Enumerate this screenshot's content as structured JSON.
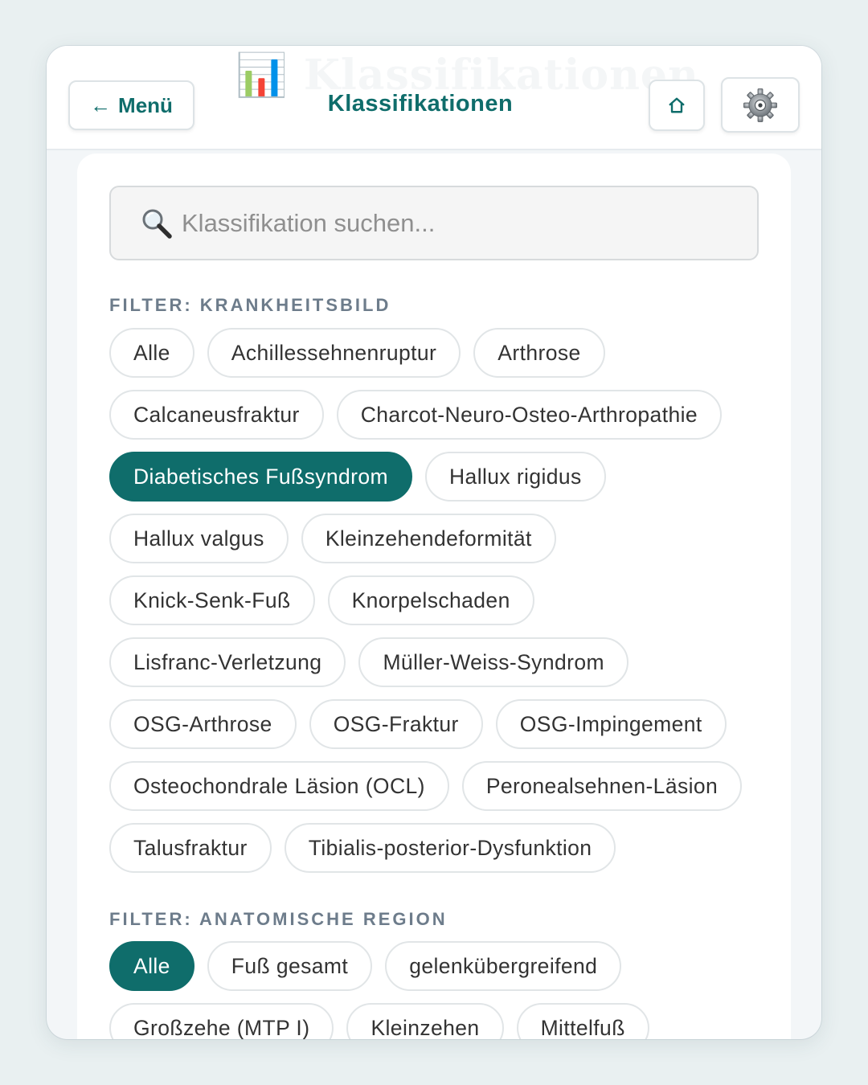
{
  "header": {
    "ghost_title": "📊 Klassifikationen",
    "title": "Klassifikationen",
    "back_label": "Menü",
    "back_arrow": "←",
    "home_icon": "home-icon",
    "settings_icon": "gear-icon"
  },
  "search": {
    "placeholder": "Klassifikation suchen...",
    "icon": "magnifier-icon"
  },
  "filters": [
    {
      "label": "FILTER: KRANKHEITSBILD",
      "chips": [
        {
          "label": "Alle",
          "active": false
        },
        {
          "label": "Achillessehnenruptur",
          "active": false
        },
        {
          "label": "Arthrose",
          "active": false
        },
        {
          "label": "Calcaneusfraktur",
          "active": false
        },
        {
          "label": "Charcot-Neuro-Osteo-Arthropathie",
          "active": false
        },
        {
          "label": "Diabetisches Fußsyndrom",
          "active": true
        },
        {
          "label": "Hallux rigidus",
          "active": false
        },
        {
          "label": "Hallux valgus",
          "active": false
        },
        {
          "label": "Kleinzehendeformität",
          "active": false
        },
        {
          "label": "Knick-Senk-Fuß",
          "active": false
        },
        {
          "label": "Knorpelschaden",
          "active": false
        },
        {
          "label": "Lisfranc-Verletzung",
          "active": false
        },
        {
          "label": "Müller-Weiss-Syndrom",
          "active": false
        },
        {
          "label": "OSG-Arthrose",
          "active": false
        },
        {
          "label": "OSG-Fraktur",
          "active": false
        },
        {
          "label": "OSG-Impingement",
          "active": false
        },
        {
          "label": "Osteochondrale Läsion (OCL)",
          "active": false
        },
        {
          "label": "Peronealsehnen-Läsion",
          "active": false
        },
        {
          "label": "Talusfraktur",
          "active": false
        },
        {
          "label": "Tibialis-posterior-Dysfunktion",
          "active": false
        }
      ]
    },
    {
      "label": "FILTER: ANATOMISCHE REGION",
      "chips": [
        {
          "label": "Alle",
          "active": true
        },
        {
          "label": "Fuß gesamt",
          "active": false
        },
        {
          "label": "gelenkübergreifend",
          "active": false
        },
        {
          "label": "Großzehe (MTP I)",
          "active": false
        },
        {
          "label": "Kleinzehen",
          "active": false
        },
        {
          "label": "Mittelfuß",
          "active": false
        }
      ]
    }
  ],
  "colors": {
    "accent": "#0f6d6b",
    "section_label": "#6d7c8b",
    "chip_border": "#e1e5e7"
  }
}
